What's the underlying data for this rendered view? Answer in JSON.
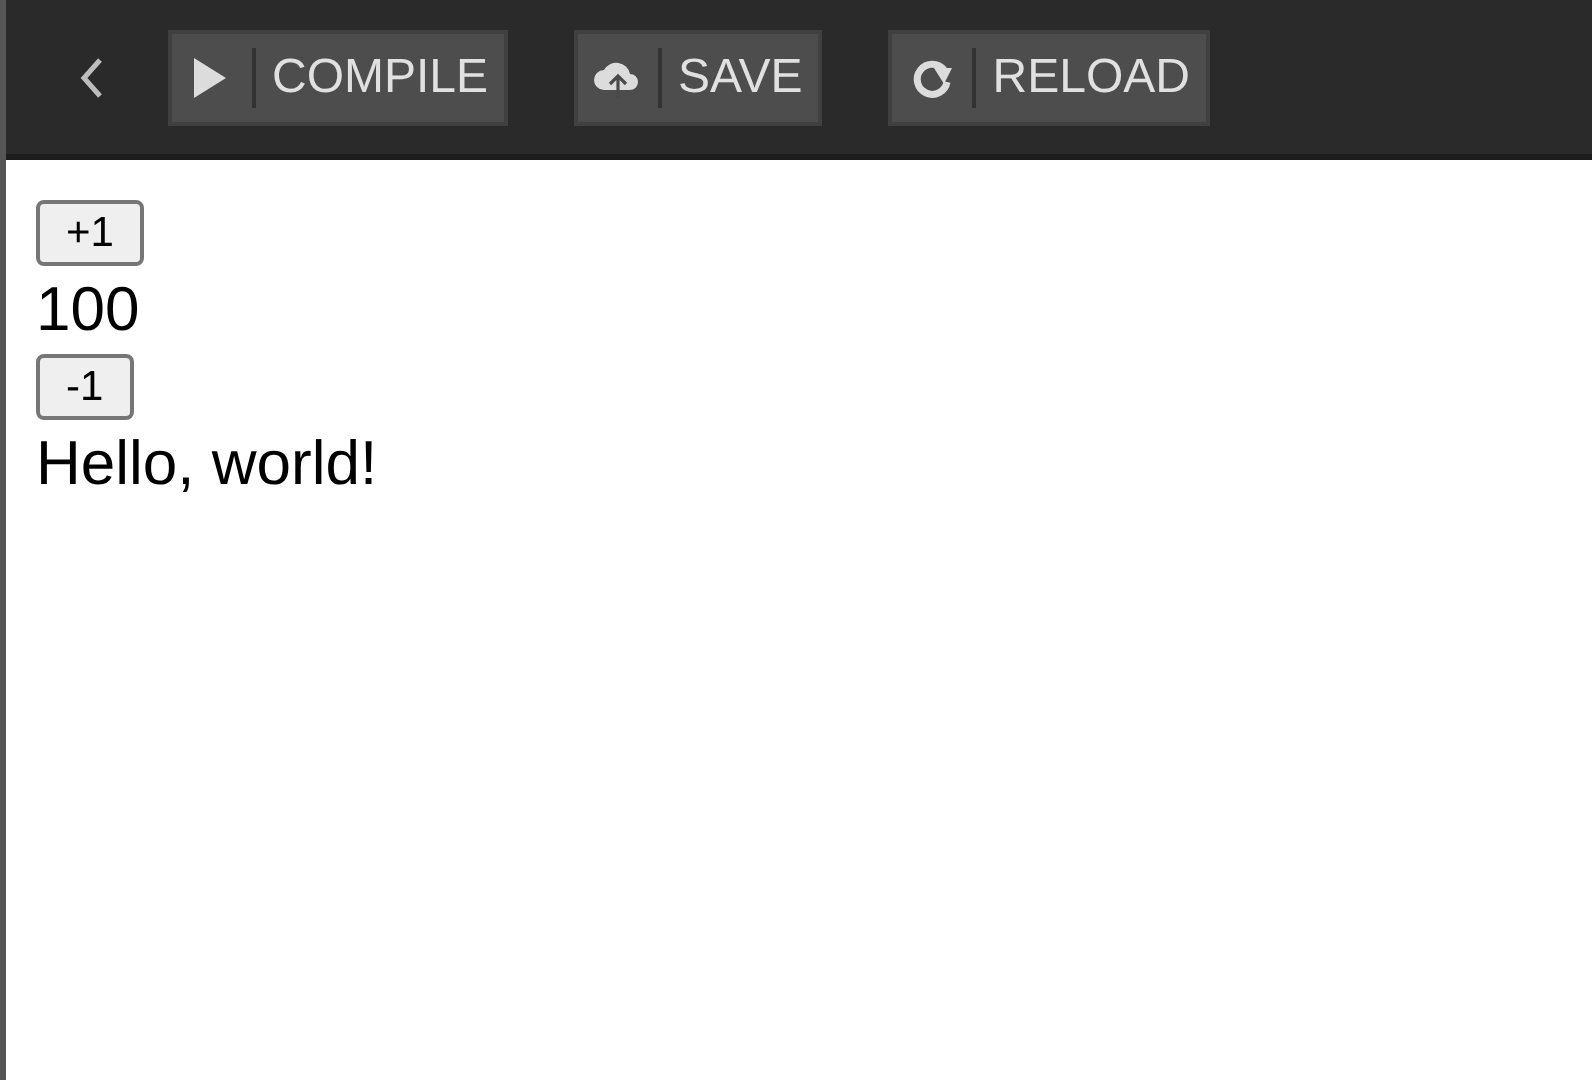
{
  "toolbar": {
    "buttons": [
      {
        "label": "COMPILE"
      },
      {
        "label": "SAVE"
      },
      {
        "label": "RELOAD"
      }
    ]
  },
  "content": [
    {
      "kind": "button",
      "text": "+1"
    },
    {
      "kind": "text",
      "text": "100"
    },
    {
      "kind": "button",
      "text": "-1"
    },
    {
      "kind": "text",
      "text": "Hello, world!"
    }
  ]
}
